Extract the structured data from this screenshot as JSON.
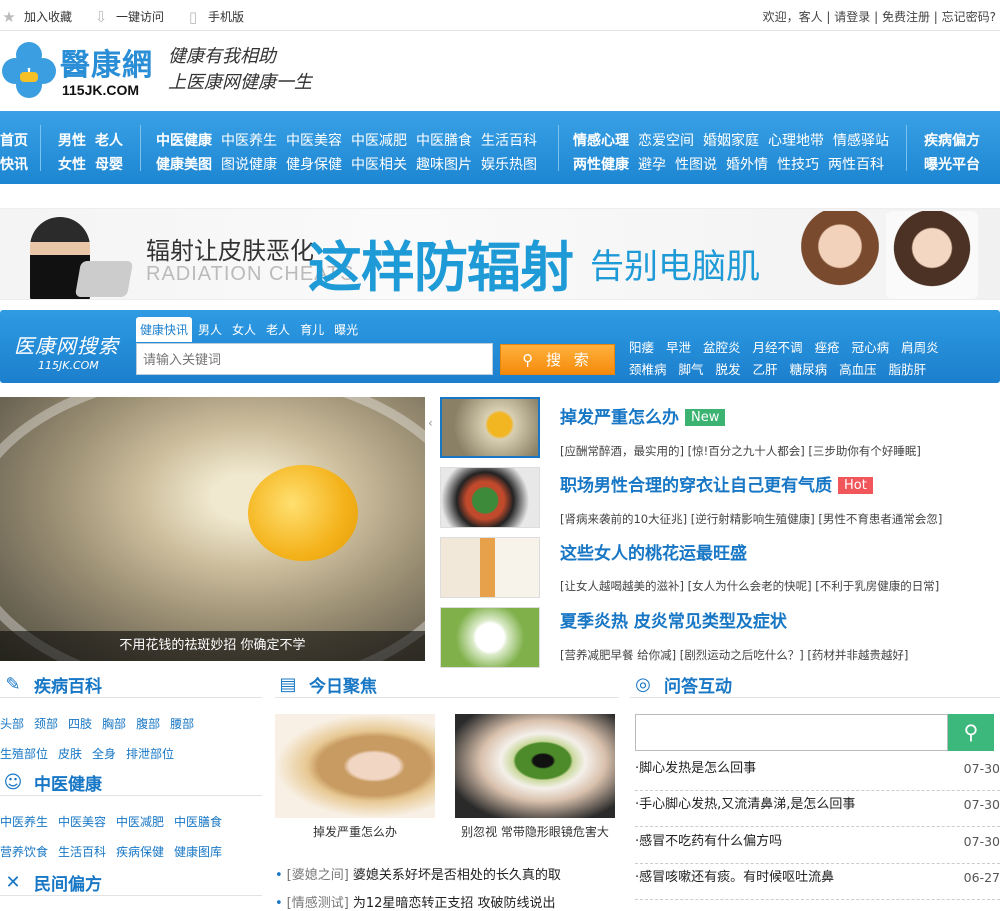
{
  "topbar": {
    "favorite": "加入收藏",
    "quick_visit": "一键访问",
    "mobile": "手机版",
    "welcome": "欢迎，客人",
    "login": "请登录",
    "register": "免费注册",
    "forgot": "忘记密码?"
  },
  "header": {
    "logo_cn": "醫康網",
    "logo_en": "115JK.COM",
    "slogan_line1": "健康有我相助",
    "slogan_line2": "上医康网健康一生"
  },
  "nav": {
    "col1_row1": [
      "首页"
    ],
    "col1_row2": [
      "快讯"
    ],
    "col2_row1": [
      "男性",
      "老人"
    ],
    "col2_row2": [
      "女性",
      "母婴"
    ],
    "col3_row1": [
      "中医健康",
      "中医养生",
      "中医美容",
      "中医减肥",
      "中医膳食",
      "生活百科"
    ],
    "col3_row2": [
      "健康美图",
      "图说健康",
      "健身保健",
      "中医相关",
      "趣味图片",
      "娱乐热图"
    ],
    "col4_row1": [
      "情感心理",
      "恋爱空间",
      "婚姻家庭",
      "心理地带",
      "情感驿站"
    ],
    "col4_row2": [
      "两性健康",
      "避孕",
      "性图说",
      "婚外情",
      "性技巧",
      "两性百科"
    ],
    "col5_row1": [
      "疾病偏方"
    ],
    "col5_row2": [
      "曝光平台"
    ]
  },
  "banner": {
    "line1": "辐射让皮肤恶化",
    "line2": "RADIATION CHEATS",
    "headline": "这样防辐射",
    "tail": "告别电脑肌"
  },
  "search": {
    "logo_cn": "医康网搜索",
    "logo_en": "115JK.COM",
    "tabs": [
      "健康快讯",
      "男人",
      "女人",
      "老人",
      "育儿",
      "曝光"
    ],
    "placeholder": "请输入关键词",
    "button": "搜 索",
    "keywords_row1": [
      "阳痿",
      "早泄",
      "盆腔炎",
      "月经不调",
      "痤疮",
      "冠心病",
      "肩周炎"
    ],
    "keywords_row2": [
      "颈椎病",
      "脚气",
      "脱发",
      "乙肝",
      "糖尿病",
      "高血压",
      "脂肪肝"
    ]
  },
  "focus": {
    "main_caption": "不用花钱的祛斑妙招 你确定不学",
    "articles": [
      {
        "title": "掉发严重怎么办",
        "badge": "New",
        "badge_color": "#3cb371",
        "sub": "[应酬常醉酒，最实用的] [惊!百分之九十人都会] [三步助你有个好睡眠]"
      },
      {
        "title": "职场男性合理的穿衣让自己更有气质",
        "badge": "Hot",
        "badge_color": "#f0565a",
        "sub": "[肾病来袭前的10大征兆] [逆行射精影响生殖健康] [男性不育患者通常会忽]"
      },
      {
        "title": "这些女人的桃花运最旺盛",
        "badge": "",
        "badge_color": "",
        "sub": "[让女人越喝越美的滋补] [女人为什么会老的快呢] [不利于乳房健康的日常]"
      },
      {
        "title": "夏季炎热 皮炎常见类型及症状",
        "badge": "",
        "badge_color": "",
        "sub": "[营养减肥早餐 给你减] [剧烈运动之后吃什么？] [药材并非越贵越好]"
      }
    ]
  },
  "disease": {
    "title": "疾病百科",
    "row1": [
      "头部",
      "颈部",
      "四肢",
      "胸部",
      "腹部",
      "腰部"
    ],
    "row2": [
      "生殖部位",
      "皮肤",
      "全身",
      "排泄部位"
    ]
  },
  "tcm": {
    "title": "中医健康",
    "row1": [
      "中医养生",
      "中医美容",
      "中医减肥",
      "中医膳食"
    ],
    "row2": [
      "营养饮食",
      "生活百科",
      "疾病保健",
      "健康图库"
    ]
  },
  "folk": {
    "title": "民间偏方"
  },
  "today": {
    "title": "今日聚焦",
    "pic1_caption": "掉发严重怎么办",
    "pic2_caption": "别忽视 常带隐形眼镜危害大",
    "list": [
      {
        "tag": "[婆媳之间]",
        "title": "婆媳关系好坏是否相处的长久真的取"
      },
      {
        "tag": "[情感测试]",
        "title": "为12星暗恋转正支招 攻破防线说出"
      }
    ]
  },
  "qa": {
    "title": "问答互动",
    "items": [
      {
        "q": "脚心发热是怎么回事",
        "date": "07-30"
      },
      {
        "q": "手心脚心发热,又流清鼻涕,是怎么回事",
        "date": "07-30"
      },
      {
        "q": "感冒不吃药有什么偏方吗",
        "date": "07-30"
      },
      {
        "q": "感冒咳嗽还有痰。有时候呕吐流鼻",
        "date": "06-27"
      }
    ]
  },
  "colors": {
    "brand_blue": "#1877c5",
    "nav_blue": "#2591dc",
    "search_orange": "#f79a1e",
    "qa_green": "#3cb87c"
  }
}
